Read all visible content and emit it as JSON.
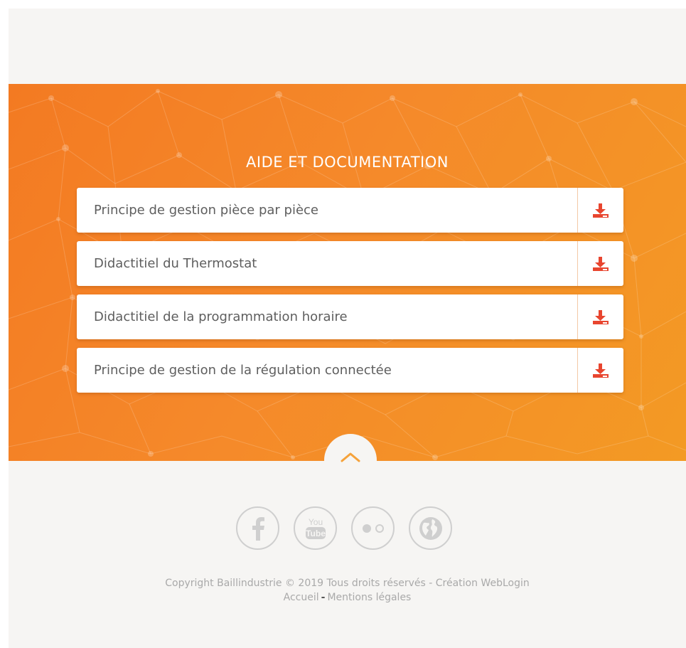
{
  "section": {
    "title": "AIDE ET DOCUMENTATION"
  },
  "documents": [
    {
      "label": "Principe de gestion pièce par pièce"
    },
    {
      "label": "Didactitiel du Thermostat"
    },
    {
      "label": "Didactitiel de la programmation horaire"
    },
    {
      "label": "Principe de gestion de la régulation connectée"
    }
  ],
  "icons": {
    "download": "download-icon",
    "back_to_top": "chevron-up-icon",
    "social": [
      "facebook-icon",
      "youtube-icon",
      "flickr-icon",
      "globe-icon"
    ]
  },
  "social": {
    "youtube_top": "You",
    "youtube_bottom": "Tube"
  },
  "footer": {
    "copyright": "Copyright Baillindustrie © 2019 Tous droits réservés - Création WebLogin",
    "link_home": "Accueil",
    "separator": "-",
    "link_legal": "Mentions légales"
  },
  "colors": {
    "hero_start": "#f37a22",
    "hero_end": "#f39a24",
    "download_icon": "#e8452f",
    "page_bg": "#f6f5f3",
    "footer_text": "#a9a9a9"
  }
}
